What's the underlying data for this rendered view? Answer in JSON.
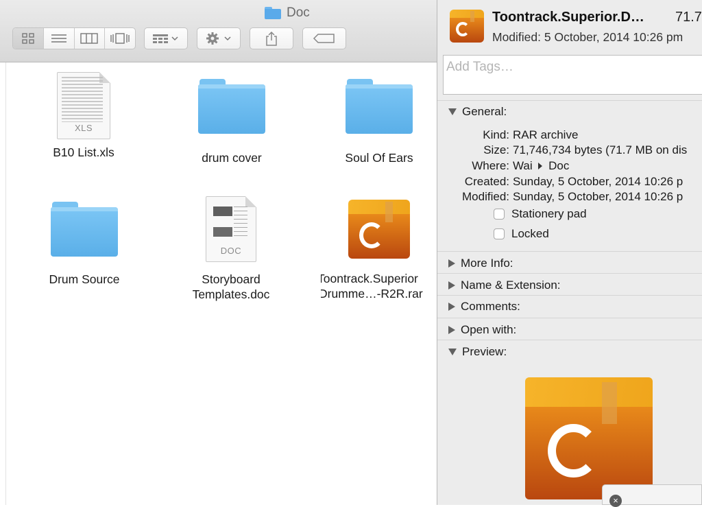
{
  "finder": {
    "title": "Doc",
    "toolbar": {
      "view_icon": "view-icons-icon",
      "view_list": "view-list-icon",
      "view_columns": "view-columns-icon",
      "view_coverflow": "view-coverflow-icon",
      "arrange": "arrange-icon",
      "action": "gear-icon",
      "share": "share-icon",
      "tag": "tag-icon"
    },
    "items": [
      {
        "label": "B10 List.xls",
        "type": "xls",
        "tag": "XLS"
      },
      {
        "label": "drum cover",
        "type": "folder"
      },
      {
        "label": "Soul Of Ears",
        "type": "folder"
      },
      {
        "label": "Drum Source",
        "type": "folder"
      },
      {
        "label_line1": "Storyboard",
        "label_line2": "Templates.doc",
        "type": "doc",
        "tag": "DOC"
      },
      {
        "label_line1": "Toontrack.Superior",
        "label_line2": "Drumme…-R2R.rar",
        "type": "rar"
      }
    ]
  },
  "info": {
    "title": "Toontrack.Superior.D…",
    "size_short": "71.7",
    "modified_header": "Modified: 5 October, 2014 10:26 pm",
    "tags_placeholder": "Add Tags…",
    "general": {
      "heading": "General:",
      "kind_key": "Kind:",
      "kind_val": "RAR archive",
      "size_key": "Size:",
      "size_val": "71,746,734 bytes (71.7 MB on dis",
      "where_key": "Where:",
      "where_val_a": "Wai",
      "where_val_b": "Doc",
      "created_key": "Created:",
      "created_val": "Sunday, 5 October, 2014 10:26 p",
      "modified_key": "Modified:",
      "modified_val": "Sunday, 5 October, 2014 10:26 p",
      "stationery": "Stationery pad",
      "locked": "Locked"
    },
    "sections": {
      "more_info": "More Info:",
      "name_ext": "Name & Extension:",
      "comments": "Comments:",
      "open_with": "Open with:",
      "preview": "Preview:"
    }
  }
}
